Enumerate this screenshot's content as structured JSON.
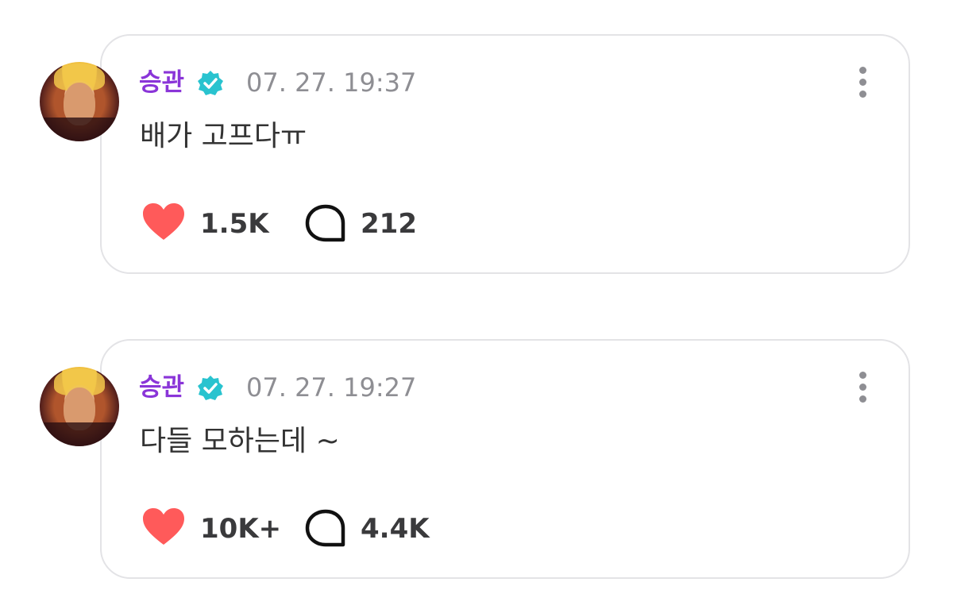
{
  "posts": [
    {
      "author": "승관",
      "verified_icon": "verified-badge-icon",
      "timestamp": "07. 27. 19:37",
      "text": "배가 고프다ㅠ",
      "likes": "1.5K",
      "comments": "212"
    },
    {
      "author": "승관",
      "verified_icon": "verified-badge-icon",
      "timestamp": "07. 27. 19:27",
      "text": "다들 모하는데 ~",
      "likes": "10K+",
      "comments": "4.4K"
    }
  ],
  "colors": {
    "author_name": "#8a35d8",
    "verified_badge": "#29c3cf",
    "heart": "#ff5a5a",
    "card_border": "#e3e3e6",
    "timestamp": "#8e8e93"
  }
}
